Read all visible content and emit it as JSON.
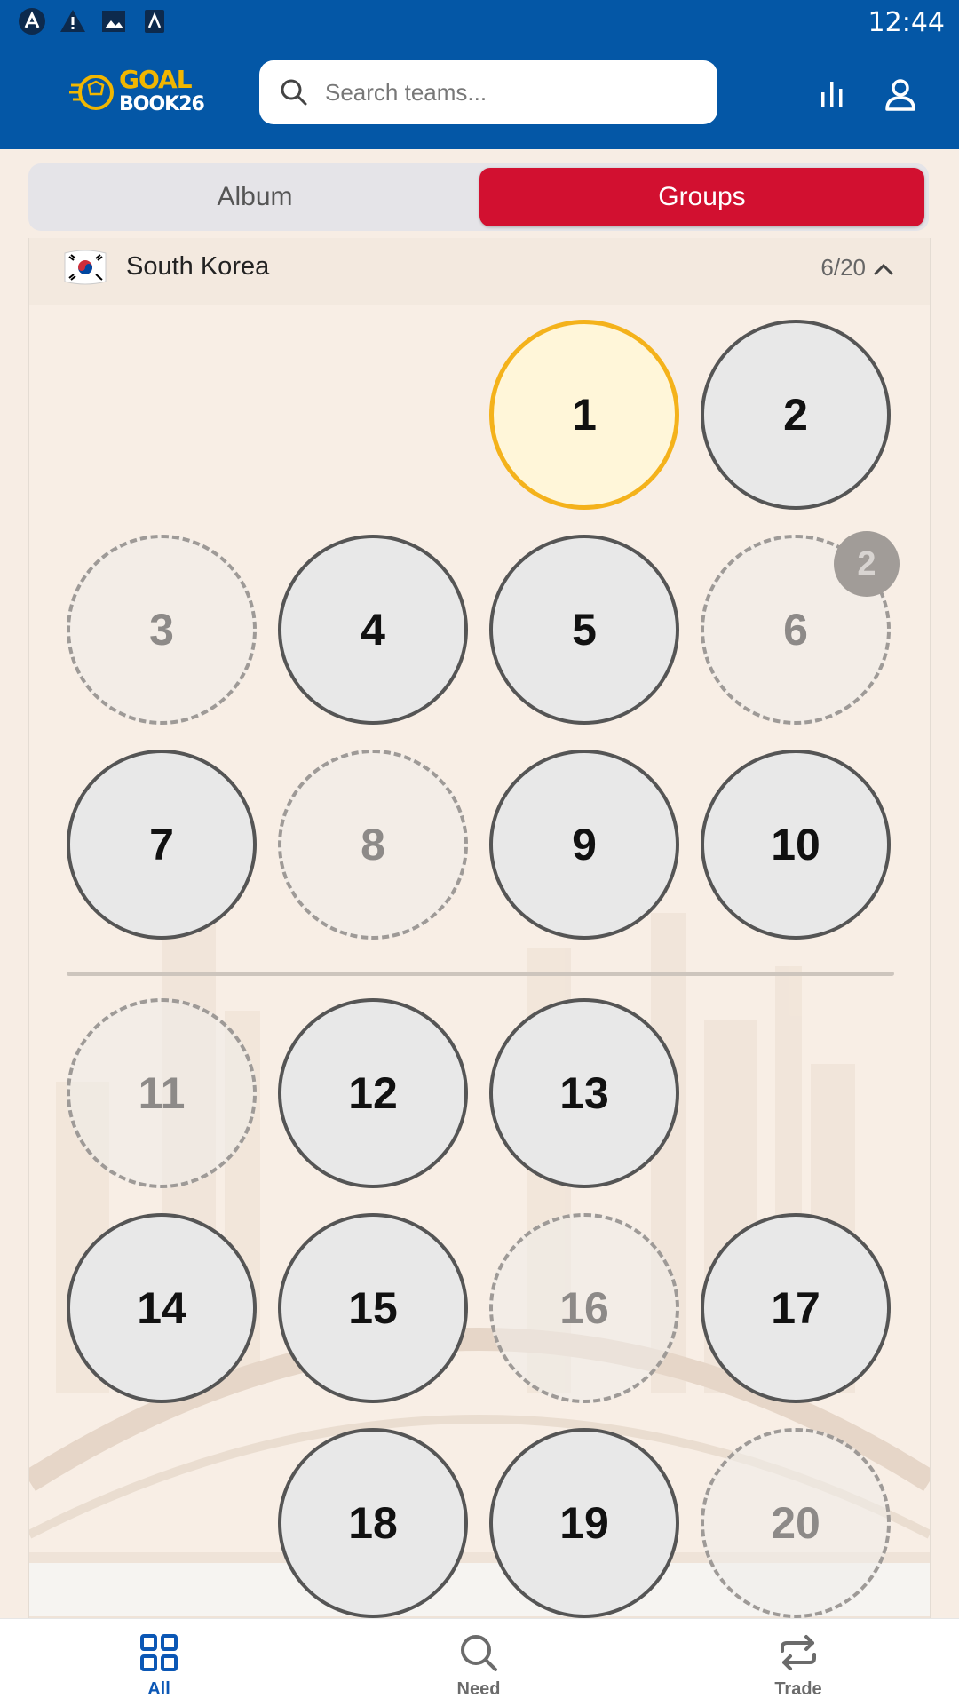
{
  "status_bar": {
    "time": "12:44",
    "icons": [
      "app-notification-icon",
      "warning-icon",
      "image-icon",
      "app-icon"
    ]
  },
  "header": {
    "logo": {
      "line1": "GOAL",
      "line2": "BOOK26"
    },
    "search": {
      "placeholder": "Search teams...",
      "value": ""
    },
    "actions": [
      "stats-icon",
      "profile-icon"
    ]
  },
  "tabs": [
    {
      "label": "Album",
      "active": false
    },
    {
      "label": "Groups",
      "active": true
    }
  ],
  "team": {
    "name": "South Korea",
    "count": "6/20",
    "flag": "south-korea-flag-icon",
    "expanded": true
  },
  "stickers": [
    {
      "number": "1",
      "state": "selected"
    },
    {
      "number": "2",
      "state": "owned"
    },
    {
      "number": "3",
      "state": "missing"
    },
    {
      "number": "4",
      "state": "owned"
    },
    {
      "number": "5",
      "state": "owned"
    },
    {
      "number": "6",
      "state": "missing",
      "badge": "2"
    },
    {
      "number": "7",
      "state": "owned"
    },
    {
      "number": "8",
      "state": "missing"
    },
    {
      "number": "9",
      "state": "owned"
    },
    {
      "number": "10",
      "state": "owned"
    },
    {
      "number": "11",
      "state": "missing"
    },
    {
      "number": "12",
      "state": "owned"
    },
    {
      "number": "13",
      "state": "owned"
    },
    {
      "number": "14",
      "state": "owned"
    },
    {
      "number": "15",
      "state": "owned"
    },
    {
      "number": "16",
      "state": "missing"
    },
    {
      "number": "17",
      "state": "owned"
    },
    {
      "number": "18",
      "state": "owned"
    },
    {
      "number": "19",
      "state": "owned"
    },
    {
      "number": "20",
      "state": "missing"
    }
  ],
  "bottom_nav": [
    {
      "label": "All",
      "icon": "grid-icon",
      "active": true
    },
    {
      "label": "Need",
      "icon": "search-icon",
      "active": false
    },
    {
      "label": "Trade",
      "icon": "trade-arrows-icon",
      "active": false
    }
  ],
  "colors": {
    "primary_blue": "#0457a6",
    "groups_red": "#d21030",
    "selected_gold": "#f4b21b",
    "active_nav": "#0b57b5"
  }
}
